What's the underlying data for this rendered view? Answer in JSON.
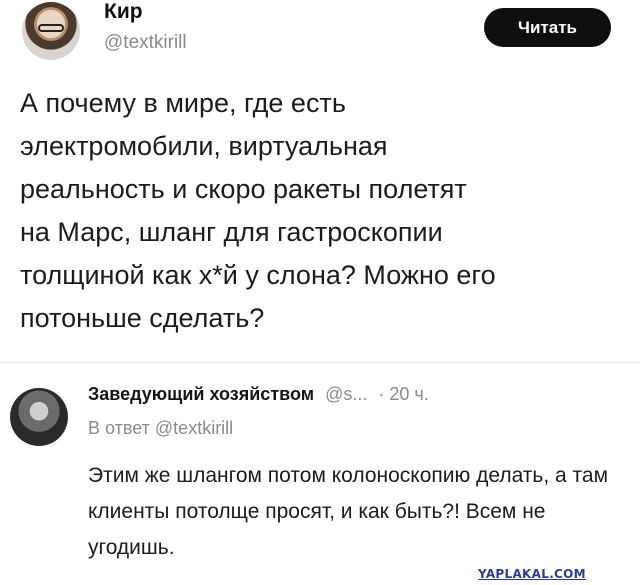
{
  "post": {
    "author_name": "Кир",
    "author_handle": "@textkirill",
    "read_button_label": "Читать",
    "text": "А почему в мире, где есть\nэлектромобили, виртуальная\nреальность и скоро ракеты полетят\nна Марс, шланг для гастроскопии\nтолщиной как х*й у слона? Можно его\nпотоньше сделать?"
  },
  "reply": {
    "author_name": "Заведующий хозяйством",
    "author_handle": "@s...",
    "time": "· 20 ч.",
    "reply_prefix": "В ответ",
    "reply_mention": "@textkirill",
    "text": "Этим же шлангом потом колоноскопию делать, а там клиенты потолще просят, и как быть?! Всем не угодишь."
  },
  "watermark": "YAPLAKAL.COM"
}
